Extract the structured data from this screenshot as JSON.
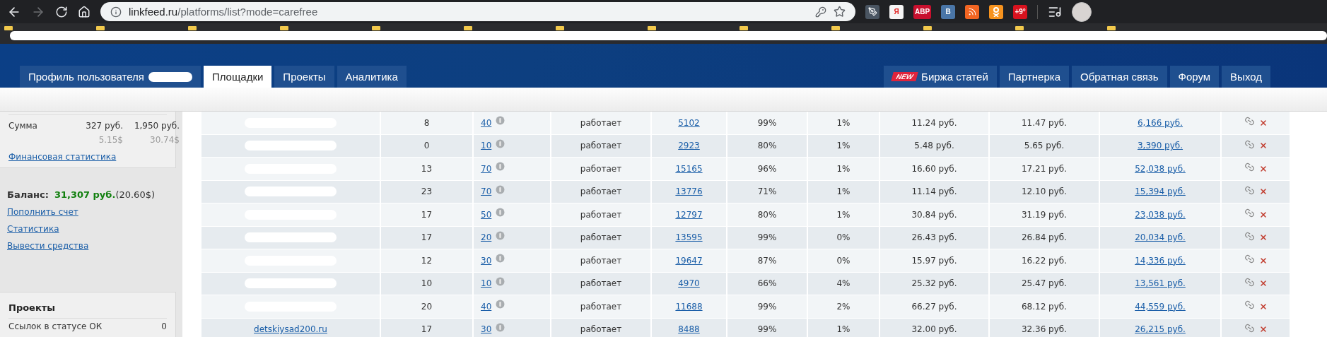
{
  "browser": {
    "forward_disabled": true,
    "url_host": "linkfeed.ru",
    "url_path": "/platforms/list?mode=carefree",
    "extensions": [
      {
        "kind": "pen"
      },
      {
        "kind": "yandex",
        "label": "Я"
      },
      {
        "kind": "abp",
        "label": "ABP"
      },
      {
        "kind": "vk",
        "label": "В"
      },
      {
        "kind": "rss"
      },
      {
        "kind": "ok"
      },
      {
        "kind": "weather",
        "label": "+9°"
      }
    ]
  },
  "nav": {
    "left_tabs": [
      {
        "label": "Профиль пользователя",
        "redacted": true,
        "selected": false
      },
      {
        "label": "Площадки",
        "redacted": false,
        "selected": true
      },
      {
        "label": "Проекты",
        "redacted": false,
        "selected": false
      },
      {
        "label": "Аналитика",
        "redacted": false,
        "selected": false
      }
    ],
    "right_tabs": [
      {
        "label": "Биржа статей",
        "badge": "NEW",
        "selected": false
      },
      {
        "label": "Партнерка",
        "selected": false
      },
      {
        "label": "Обратная связь",
        "selected": false
      },
      {
        "label": "Форум",
        "selected": false
      },
      {
        "label": "Выход",
        "selected": false
      }
    ]
  },
  "sidebar": {
    "sum": {
      "label": "Сумма",
      "values": [
        "327 руб.",
        "1,950 руб."
      ],
      "usd": [
        "5.15$",
        "30.74$"
      ]
    },
    "finance_link": "Финансовая статистика",
    "balance": {
      "label": "Баланс:",
      "rub": "31,307 руб.",
      "usd": "(20.60$)"
    },
    "links": [
      "Пополнить счет",
      "Статистика",
      "Вывести средства"
    ],
    "projects": {
      "title": "Проекты",
      "rows": [
        {
          "label": "Ссылок в статусе ОК",
          "value": "0"
        }
      ]
    }
  },
  "table": {
    "rows": [
      {
        "redacted": true,
        "column_2": "8",
        "column_3": "40",
        "column_4": "работает",
        "column_5": "5102",
        "column_6": "99%",
        "column_7": "1%",
        "column_8": "11.24 руб.",
        "column_9": "11.47 руб.",
        "column_10": "6,166 руб."
      },
      {
        "redacted": true,
        "column_2": "0",
        "column_3": "10",
        "column_4": "работает",
        "column_5": "2923",
        "column_6": "80%",
        "column_7": "1%",
        "column_8": "5.48 руб.",
        "column_9": "5.65 руб.",
        "column_10": "3,390 руб."
      },
      {
        "redacted": true,
        "column_2": "13",
        "column_3": "70",
        "column_4": "работает",
        "column_5": "15165",
        "column_6": "96%",
        "column_7": "1%",
        "column_8": "16.60 руб.",
        "column_9": "17.21 руб.",
        "column_10": "52,038 руб."
      },
      {
        "redacted": true,
        "column_2": "23",
        "column_3": "70",
        "column_4": "работает",
        "column_5": "13776",
        "column_6": "71%",
        "column_7": "1%",
        "column_8": "11.14 руб.",
        "column_9": "12.10 руб.",
        "column_10": "15,394 руб."
      },
      {
        "redacted": true,
        "column_2": "17",
        "column_3": "50",
        "column_4": "работает",
        "column_5": "12797",
        "column_6": "80%",
        "column_7": "1%",
        "column_8": "30.84 руб.",
        "column_9": "31.19 руб.",
        "column_10": "23,038 руб."
      },
      {
        "redacted": true,
        "column_2": "17",
        "column_3": "20",
        "column_4": "работает",
        "column_5": "13595",
        "column_6": "99%",
        "column_7": "0%",
        "column_8": "26.43 руб.",
        "column_9": "26.84 руб.",
        "column_10": "20,034 руб."
      },
      {
        "redacted": true,
        "column_2": "12",
        "column_3": "30",
        "column_4": "работает",
        "column_5": "19647",
        "column_6": "87%",
        "column_7": "0%",
        "column_8": "15.97 руб.",
        "column_9": "16.22 руб.",
        "column_10": "14,336 руб."
      },
      {
        "redacted": true,
        "column_2": "10",
        "column_3": "10",
        "column_4": "работает",
        "column_5": "4970",
        "column_6": "66%",
        "column_7": "4%",
        "column_8": "25.32 руб.",
        "column_9": "25.47 руб.",
        "column_10": "13,561 руб."
      },
      {
        "redacted": true,
        "column_2": "20",
        "column_3": "40",
        "column_4": "работает",
        "column_5": "11688",
        "column_6": "99%",
        "column_7": "2%",
        "column_8": "66.27 руб.",
        "column_9": "68.12 руб.",
        "column_10": "44,559 руб."
      },
      {
        "redacted": false,
        "column_1": "detskiysad200.ru",
        "column_2": "17",
        "column_3": "30",
        "column_4": "работает",
        "column_5": "8488",
        "column_6": "99%",
        "column_7": "1%",
        "column_8": "32.00 руб.",
        "column_9": "32.36 руб.",
        "column_10": "26,215 руб."
      }
    ]
  }
}
